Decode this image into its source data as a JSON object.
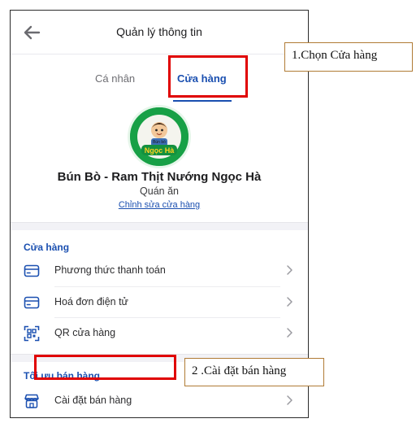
{
  "header": {
    "title": "Quản lý thông tin",
    "back_icon": "arrow-left-icon"
  },
  "tabs": [
    {
      "label": "Cá nhân",
      "active": false
    },
    {
      "label": "Cửa hàng",
      "active": true
    }
  ],
  "store": {
    "logo_icon": "store-logo",
    "logo_text_top": "Bún bò",
    "logo_text_main": "Ngọc Hà",
    "name": "Bún Bò - Ram Thịt Nướng Ngọc Hà",
    "type": "Quán ăn",
    "edit_link": "Chỉnh sửa cửa hàng"
  },
  "section_store": {
    "title": "Cửa hàng",
    "items": [
      {
        "label": "Phương thức thanh toán",
        "icon": "card-icon"
      },
      {
        "label": "Hoá đơn điện tử",
        "icon": "invoice-card-icon"
      },
      {
        "label": "QR cửa hàng",
        "icon": "qr-code-icon"
      }
    ]
  },
  "section_sales": {
    "title": "Tối ưu bán hàng",
    "items": [
      {
        "label": "Cài đặt bán hàng",
        "icon": "store-settings-icon"
      }
    ]
  },
  "annotations": {
    "step1": "1.Chọn Cửa hàng",
    "step2": "2 .Cài đặt bán hàng",
    "highlight_color": "#e00000"
  },
  "colors": {
    "accent": "#1a4fb0",
    "logo_green": "#1aa24a"
  }
}
